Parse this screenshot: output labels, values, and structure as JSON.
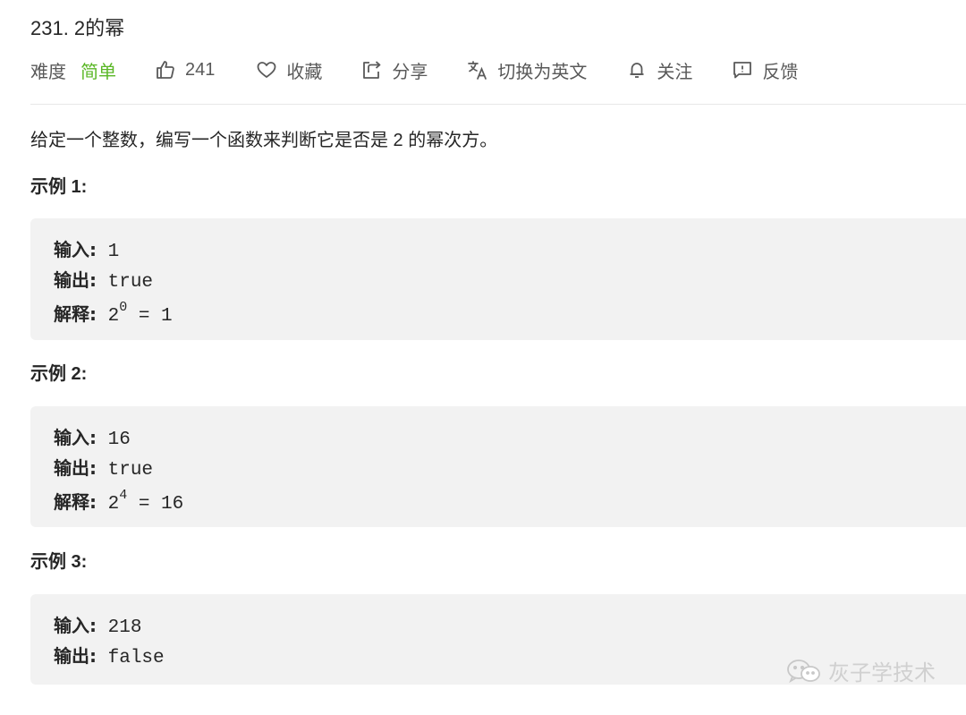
{
  "problem": {
    "title": "231. 2的幂"
  },
  "meta": {
    "difficulty_label": "难度",
    "difficulty_value": "简单",
    "likes": "241",
    "favorite_label": "收藏",
    "share_label": "分享",
    "translate_label": "切换为英文",
    "follow_label": "关注",
    "feedback_label": "反馈",
    "icons": {
      "like": "thumbs-up-icon",
      "favorite": "heart-icon",
      "share": "share-icon",
      "translate": "translate-icon",
      "follow": "bell-icon",
      "feedback": "feedback-icon"
    },
    "colors": {
      "difficulty_easy": "#5ab726",
      "meta_text": "#595959"
    }
  },
  "description": "给定一个整数，编写一个函数来判断它是否是 2 的幂次方。",
  "examples": [
    {
      "heading": "示例 1:",
      "input_label": "输入:",
      "input": "1",
      "output_label": "输出:",
      "output": "true",
      "explain_label": "解释:",
      "explain_base": "2",
      "explain_exp": "0",
      "explain_rest": " = 1"
    },
    {
      "heading": "示例 2:",
      "input_label": "输入:",
      "input": "16",
      "output_label": "输出:",
      "output": "true",
      "explain_label": "解释:",
      "explain_base": "2",
      "explain_exp": "4",
      "explain_rest": " = 16"
    },
    {
      "heading": "示例 3:",
      "input_label": "输入:",
      "input": "218",
      "output_label": "输出:",
      "output": "false"
    }
  ],
  "watermark": {
    "text": "灰子学技术",
    "icon": "wechat-icon"
  }
}
